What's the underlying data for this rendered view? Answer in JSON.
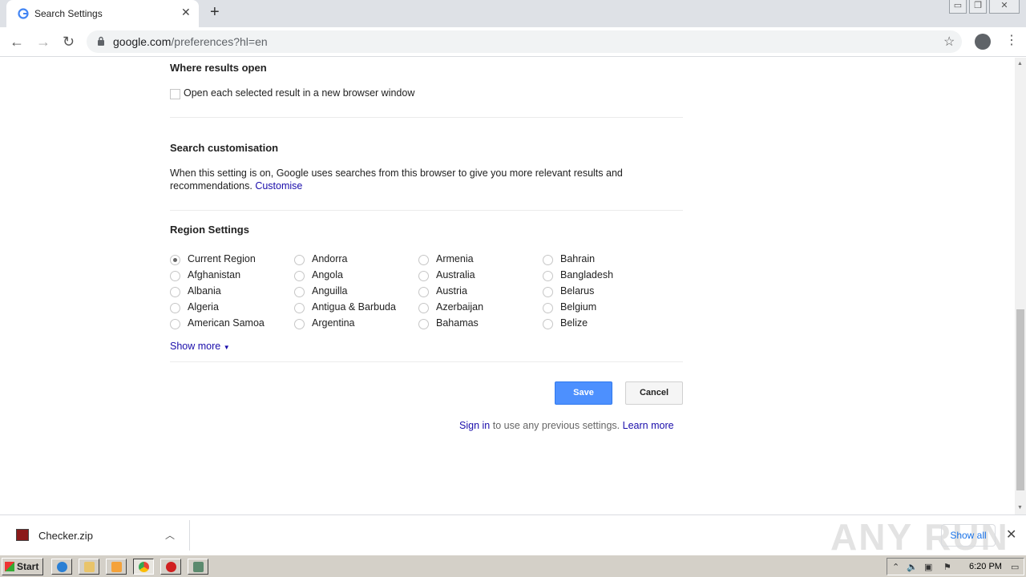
{
  "browser": {
    "tab_title": "Search Settings",
    "url_domain": "google.com",
    "url_path": "/preferences?hl=en"
  },
  "where_results_open": {
    "heading": "Where results open",
    "checkbox_label": "Open each selected result in a new browser window",
    "checked": false
  },
  "search_customisation": {
    "heading": "Search customisation",
    "description": "When this setting is on, Google uses searches from this browser to give you more relevant results and",
    "description_line2": "recommendations.",
    "link": "Customise"
  },
  "region_settings": {
    "heading": "Region Settings",
    "columns": [
      [
        "Current Region",
        "Afghanistan",
        "Albania",
        "Algeria",
        "American Samoa"
      ],
      [
        "Andorra",
        "Angola",
        "Anguilla",
        "Antigua & Barbuda",
        "Argentina"
      ],
      [
        "Armenia",
        "Australia",
        "Austria",
        "Azerbaijan",
        "Bahamas"
      ],
      [
        "Bahrain",
        "Bangladesh",
        "Belarus",
        "Belgium",
        "Belize"
      ]
    ],
    "selected": "Current Region",
    "show_more": "Show more"
  },
  "actions": {
    "save": "Save",
    "cancel": "Cancel",
    "sign_in": "Sign in",
    "sign_in_text": "to use any previous settings.",
    "learn_more": "Learn more"
  },
  "download_bar": {
    "file_name": "Checker.zip",
    "show_all": "Show all"
  },
  "watermark": "ANY RUN",
  "taskbar": {
    "start": "Start",
    "clock": "6:20 PM"
  }
}
